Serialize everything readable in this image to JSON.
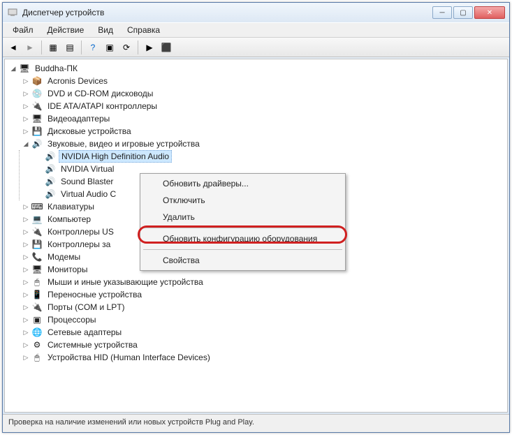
{
  "title": "Диспетчер устройств",
  "menu": {
    "file": "Файл",
    "action": "Действие",
    "view": "Вид",
    "help": "Справка"
  },
  "root": "Buddha-ПК",
  "categories": [
    {
      "label": "Acronis Devices",
      "icon": "📦"
    },
    {
      "label": "DVD и CD-ROM дисководы",
      "icon": "💿"
    },
    {
      "label": "IDE ATA/ATAPI контроллеры",
      "icon": "🔌"
    },
    {
      "label": "Видеоадаптеры",
      "icon": "🖥"
    },
    {
      "label": "Дисковые устройства",
      "icon": "💾"
    },
    {
      "label": "Звуковые, видео и игровые устройства",
      "icon": "🔊",
      "expanded": true,
      "children": [
        {
          "label": "NVIDIA High Definition Audio",
          "selected": true
        },
        {
          "label": "NVIDIA Virtual"
        },
        {
          "label": "Sound Blaster"
        },
        {
          "label": "Virtual Audio C"
        }
      ]
    },
    {
      "label": "Клавиатуры",
      "icon": "⌨"
    },
    {
      "label": "Компьютер",
      "icon": "💻"
    },
    {
      "label": "Контроллеры US",
      "icon": "🔌"
    },
    {
      "label": "Контроллеры за",
      "icon": "💾"
    },
    {
      "label": "Модемы",
      "icon": "📞"
    },
    {
      "label": "Мониторы",
      "icon": "🖥"
    },
    {
      "label": "Мыши и иные указывающие устройства",
      "icon": "🖱"
    },
    {
      "label": "Переносные устройства",
      "icon": "📱"
    },
    {
      "label": "Порты (COM и LPT)",
      "icon": "🔌"
    },
    {
      "label": "Процессоры",
      "icon": "▣"
    },
    {
      "label": "Сетевые адаптеры",
      "icon": "🌐"
    },
    {
      "label": "Системные устройства",
      "icon": "⚙"
    },
    {
      "label": "Устройства HID (Human Interface Devices)",
      "icon": "🖱"
    }
  ],
  "context_menu": {
    "update_drivers": "Обновить драйверы...",
    "disable": "Отключить",
    "uninstall": "Удалить",
    "scan_hardware": "Обновить конфигурацию оборудования",
    "properties": "Свойства"
  },
  "status": "Проверка на наличие изменений или новых устройств Plug and Play."
}
